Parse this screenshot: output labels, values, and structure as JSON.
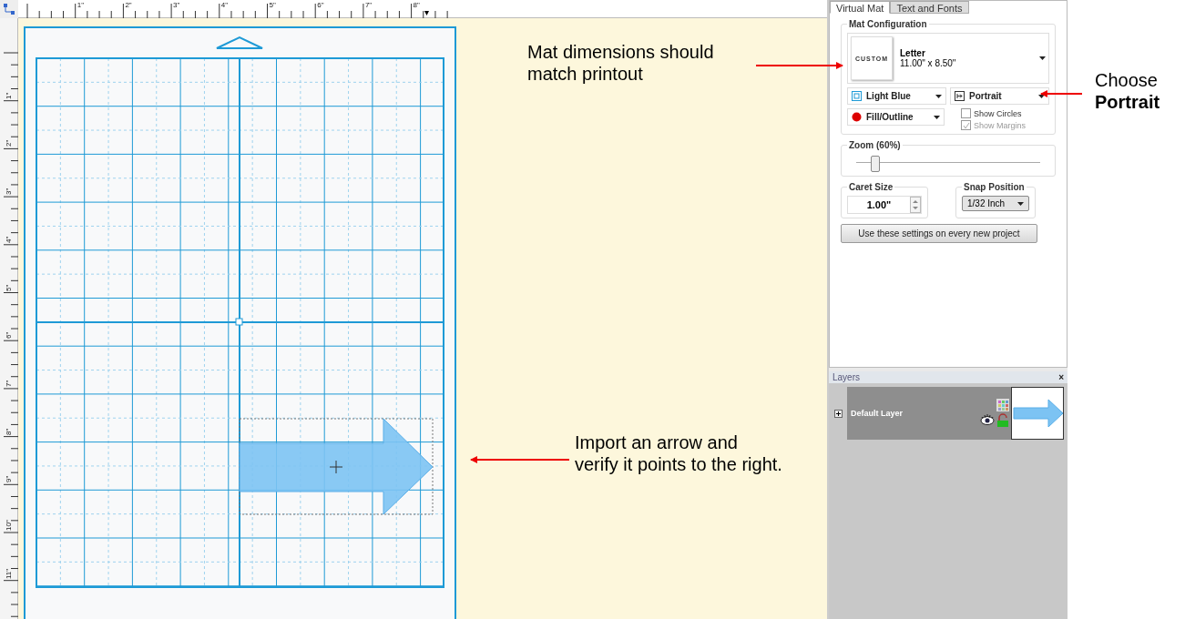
{
  "rulers": {
    "horizontal": [
      "1\"",
      "2\"",
      "3\"",
      "4\"",
      "5\"",
      "6\"",
      "7\"",
      "8\""
    ],
    "vertical": [
      "1\"",
      "2\"",
      "3\"",
      "4\"",
      "5\"",
      "6\"",
      "7\"",
      "8\"",
      "9\"",
      "10\"",
      "11\""
    ]
  },
  "canvas": {
    "annotations": [
      {
        "text": "Mat dimensions should match printout"
      },
      {
        "text": "Import an arrow and verify it points to the right."
      }
    ]
  },
  "panel": {
    "tabs": [
      {
        "label": "Virtual Mat",
        "selected": true
      },
      {
        "label": "Text and Fonts",
        "selected": false
      }
    ],
    "mat_configuration": {
      "title": "Mat Configuration",
      "badge": "CUSTOM",
      "name": "Letter",
      "size": "11.00\" x 8.50\"",
      "mat_color": "Light Blue",
      "orientation": "Portrait",
      "fill": "Fill/Outline",
      "options": [
        {
          "label": "Show Circles",
          "checked": false,
          "disabled": false
        },
        {
          "label": "Show Margins",
          "checked": true,
          "disabled": true
        }
      ]
    },
    "zoom": {
      "label": "Zoom (60%)",
      "level": 0.08
    },
    "caret_size": {
      "label": "Caret Size",
      "value": "1.00\""
    },
    "snap_position": {
      "label": "Snap Position",
      "value": "1/32 Inch"
    },
    "button": "Use these settings on every new project"
  },
  "layers": {
    "title": "Layers",
    "close": "×",
    "items": [
      {
        "name": "Default Layer"
      }
    ]
  },
  "callout": {
    "text": "Choose **Portrait**"
  }
}
